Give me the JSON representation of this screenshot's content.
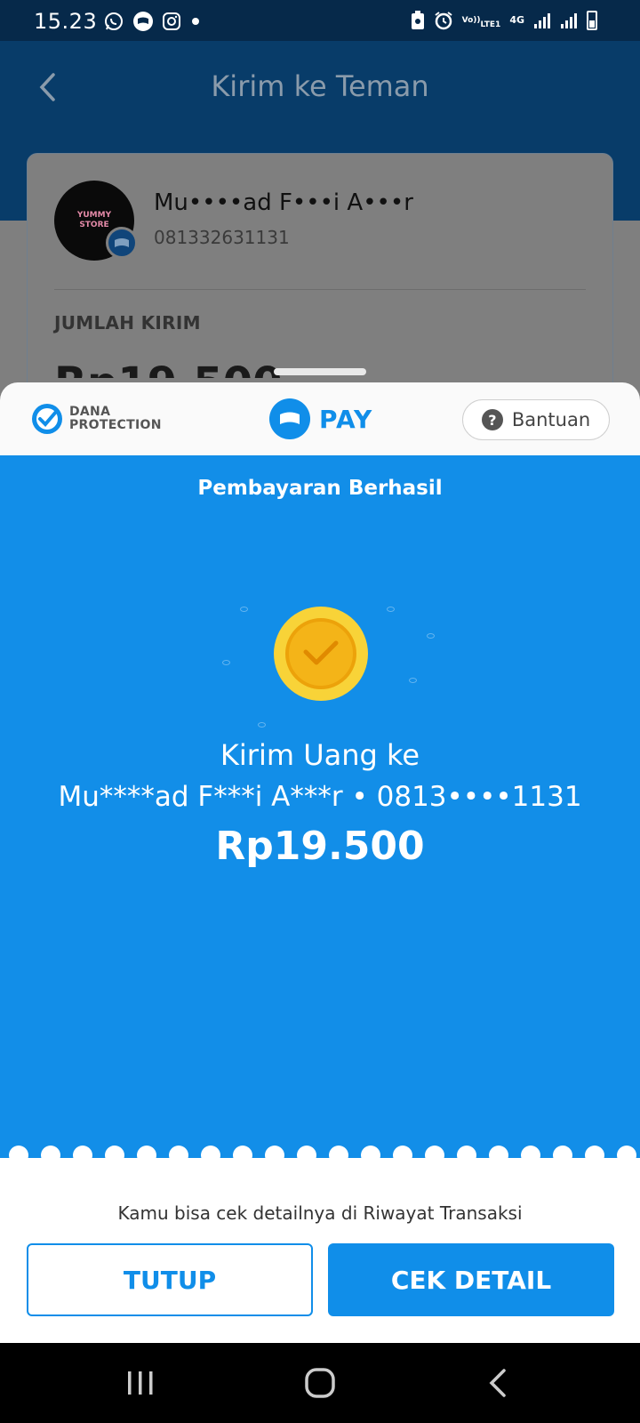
{
  "status_bar": {
    "time": "15.23",
    "left_icons": [
      "whatsapp-icon",
      "dana-icon",
      "instagram-icon",
      "dot-icon"
    ],
    "right_icons": [
      "screenshot-icon",
      "alarm-icon",
      "volte-icon",
      "4g-icon",
      "signal-icon",
      "signal-icon",
      "battery-icon"
    ],
    "volte_line1": "Vo))",
    "volte_line2": "LTE1",
    "network_type": "4G"
  },
  "background_page": {
    "title": "Kirim ke Teman",
    "recipient_name": "Mu••••ad F•••i A•••r",
    "recipient_phone": "081332631131",
    "avatar_text_1": "YUMMY",
    "avatar_text_2": "STORE",
    "amount_label": "JUMLAH KIRIM",
    "amount_value": "Rp19.500"
  },
  "sheet_header": {
    "protection_line1": "DANA",
    "protection_line2": "PROTECTION",
    "pay_label": "PAY",
    "help_label": "Bantuan"
  },
  "success": {
    "title": "Pembayaran Berhasil",
    "send_title": "Kirim Uang ke",
    "recipient": "Mu****ad F***i A***r • 0813••••1131",
    "amount": "Rp19.500"
  },
  "footer": {
    "note": "Kamu bisa cek detailnya di Riwayat Transaksi",
    "close_label": "TUTUP",
    "detail_label": "CEK DETAIL"
  },
  "colors": {
    "primary_blue": "#108ee9",
    "header_navy": "#083c69",
    "coin_yellow": "#f8d338",
    "coin_orange": "#f4b418"
  },
  "navigation_bar": [
    "recent-apps-icon",
    "home-icon",
    "back-icon"
  ]
}
